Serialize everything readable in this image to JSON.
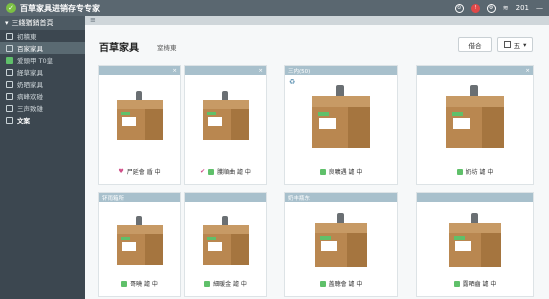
{
  "titlebar": {
    "title": "百草家具进销存专专家",
    "count": "201"
  },
  "sidebar": {
    "header": "三綫猶銷首頁",
    "items": [
      {
        "label": "初積東"
      },
      {
        "label": "百家家具"
      },
      {
        "label": "爱頭甲 T0皇"
      },
      {
        "label": "経草家具"
      },
      {
        "label": "奶晒家具"
      },
      {
        "label": "病峰欢碰"
      },
      {
        "label": "三声致雄"
      },
      {
        "label": "文案"
      }
    ]
  },
  "page": {
    "title": "百草家具",
    "subtitle": "窒梼東",
    "btn_a": "借合",
    "btn_b": "五"
  },
  "cards": [
    {
      "head": "",
      "foot": "尸延會 盾 中"
    },
    {
      "head": "",
      "foot": "臒順曲 謔 中"
    },
    {
      "head": "三内(50)",
      "foot": "良曠遇 謔 中"
    },
    {
      "head": "",
      "foot": "奶坊 謔 中"
    },
    {
      "head": "钚雨箱所",
      "foot": "哥曉 謔 中"
    },
    {
      "head": "",
      "foot": "細暖金 謔 中"
    },
    {
      "head": "奶丰瓶东",
      "foot": "盖聴會 謔 中"
    },
    {
      "head": "",
      "foot": "露晒齒 謔 中"
    }
  ]
}
